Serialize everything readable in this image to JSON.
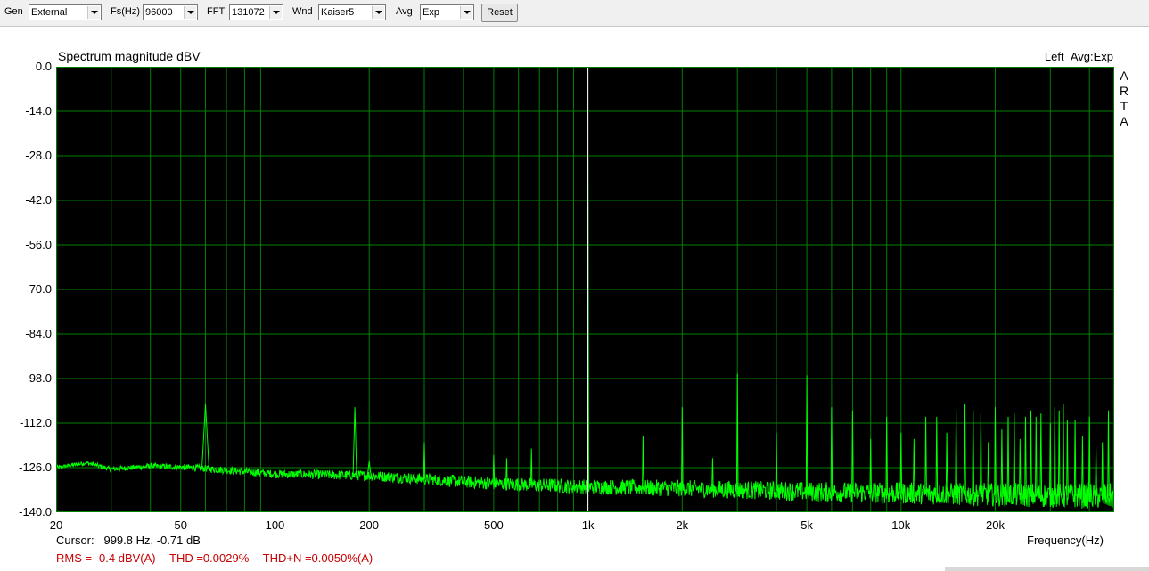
{
  "toolbar": {
    "gen_label": "Gen",
    "gen_value": "External",
    "fs_label": "Fs(Hz)",
    "fs_value": "96000",
    "fft_label": "FFT",
    "fft_value": "131072",
    "wnd_label": "Wnd",
    "wnd_value": "Kaiser5",
    "avg_label": "Avg",
    "avg_value": "Exp",
    "reset_label": "Reset"
  },
  "plot": {
    "title": "Spectrum magnitude dBV",
    "channel": "Left",
    "avg_mode": "Avg:Exp",
    "logo_letters": [
      "A",
      "R",
      "T",
      "A"
    ],
    "xlabel": "Frequency(Hz)"
  },
  "status": {
    "cursor_label": "Cursor:",
    "cursor_value": "999.8 Hz, -0.71 dB",
    "rms": "RMS =   -0.4 dBV(A)",
    "thd": "THD =0.0029%",
    "thdn": "THD+N =0.0050%(A)"
  },
  "colors": {
    "background": "#000000",
    "grid": "#008000",
    "trace": "#00ff00",
    "cursor": "#ffffff",
    "stats_text": "#c80000"
  },
  "chart_data": {
    "type": "line",
    "title": "Spectrum magnitude dBV",
    "xlabel": "Frequency(Hz)",
    "ylabel": "",
    "x_scale": "log",
    "xlim": [
      20,
      48000
    ],
    "ylim": [
      -140,
      0
    ],
    "grid": true,
    "y_ticks": [
      "0.0",
      "-14.0",
      "-28.0",
      "-42.0",
      "-56.0",
      "-70.0",
      "-84.0",
      "-98.0",
      "-112.0",
      "-126.0",
      "-140.0"
    ],
    "x_ticks": [
      {
        "value": 20,
        "label": "20"
      },
      {
        "value": 50,
        "label": "50"
      },
      {
        "value": 100,
        "label": "100"
      },
      {
        "value": 200,
        "label": "200"
      },
      {
        "value": 500,
        "label": "500"
      },
      {
        "value": 1000,
        "label": "1k"
      },
      {
        "value": 2000,
        "label": "2k"
      },
      {
        "value": 5000,
        "label": "5k"
      },
      {
        "value": 10000,
        "label": "10k"
      },
      {
        "value": 20000,
        "label": "20k"
      }
    ],
    "cursor_hz": 999.8,
    "noise_floor": [
      {
        "x": 20,
        "y": -126
      },
      {
        "x": 25,
        "y": -124.5
      },
      {
        "x": 30,
        "y": -126.5
      },
      {
        "x": 40,
        "y": -125.5
      },
      {
        "x": 55,
        "y": -126
      },
      {
        "x": 100,
        "y": -128
      },
      {
        "x": 200,
        "y": -128.5
      },
      {
        "x": 500,
        "y": -131
      },
      {
        "x": 1000,
        "y": -132
      },
      {
        "x": 2000,
        "y": -132.5
      },
      {
        "x": 5000,
        "y": -133.5
      },
      {
        "x": 10000,
        "y": -134
      },
      {
        "x": 20000,
        "y": -134.5
      },
      {
        "x": 48000,
        "y": -135
      }
    ],
    "peaks": [
      {
        "x": 60,
        "y": -106
      },
      {
        "x": 180,
        "y": -107
      },
      {
        "x": 200,
        "y": -124
      },
      {
        "x": 300,
        "y": -118
      },
      {
        "x": 500,
        "y": -122
      },
      {
        "x": 550,
        "y": -123
      },
      {
        "x": 660,
        "y": -120
      },
      {
        "x": 1000,
        "y": -29
      },
      {
        "x": 1500,
        "y": -116
      },
      {
        "x": 2000,
        "y": -107
      },
      {
        "x": 2500,
        "y": -123
      },
      {
        "x": 3000,
        "y": -96.5
      },
      {
        "x": 4000,
        "y": -115
      },
      {
        "x": 5000,
        "y": -97
      },
      {
        "x": 6000,
        "y": -107
      },
      {
        "x": 7000,
        "y": -108
      },
      {
        "x": 8000,
        "y": -117
      },
      {
        "x": 9000,
        "y": -110
      },
      {
        "x": 10000,
        "y": -115
      },
      {
        "x": 11000,
        "y": -117
      },
      {
        "x": 12000,
        "y": -110
      },
      {
        "x": 13000,
        "y": -110
      },
      {
        "x": 14000,
        "y": -115
      },
      {
        "x": 15000,
        "y": -108
      },
      {
        "x": 16000,
        "y": -106
      },
      {
        "x": 17000,
        "y": -108
      },
      {
        "x": 18000,
        "y": -109
      },
      {
        "x": 19000,
        "y": -118
      },
      {
        "x": 20000,
        "y": -107
      },
      {
        "x": 21000,
        "y": -114
      },
      {
        "x": 22000,
        "y": -110
      },
      {
        "x": 23000,
        "y": -109
      },
      {
        "x": 24000,
        "y": -117
      },
      {
        "x": 25000,
        "y": -110
      },
      {
        "x": 26000,
        "y": -108
      },
      {
        "x": 27000,
        "y": -110
      },
      {
        "x": 28000,
        "y": -109
      },
      {
        "x": 30000,
        "y": -112
      },
      {
        "x": 31000,
        "y": -107
      },
      {
        "x": 32000,
        "y": -108
      },
      {
        "x": 33000,
        "y": -106
      },
      {
        "x": 34000,
        "y": -111
      },
      {
        "x": 36000,
        "y": -111
      },
      {
        "x": 38000,
        "y": -116
      },
      {
        "x": 40000,
        "y": -110
      },
      {
        "x": 42000,
        "y": -120
      },
      {
        "x": 44000,
        "y": -118
      },
      {
        "x": 46000,
        "y": -108
      }
    ]
  }
}
